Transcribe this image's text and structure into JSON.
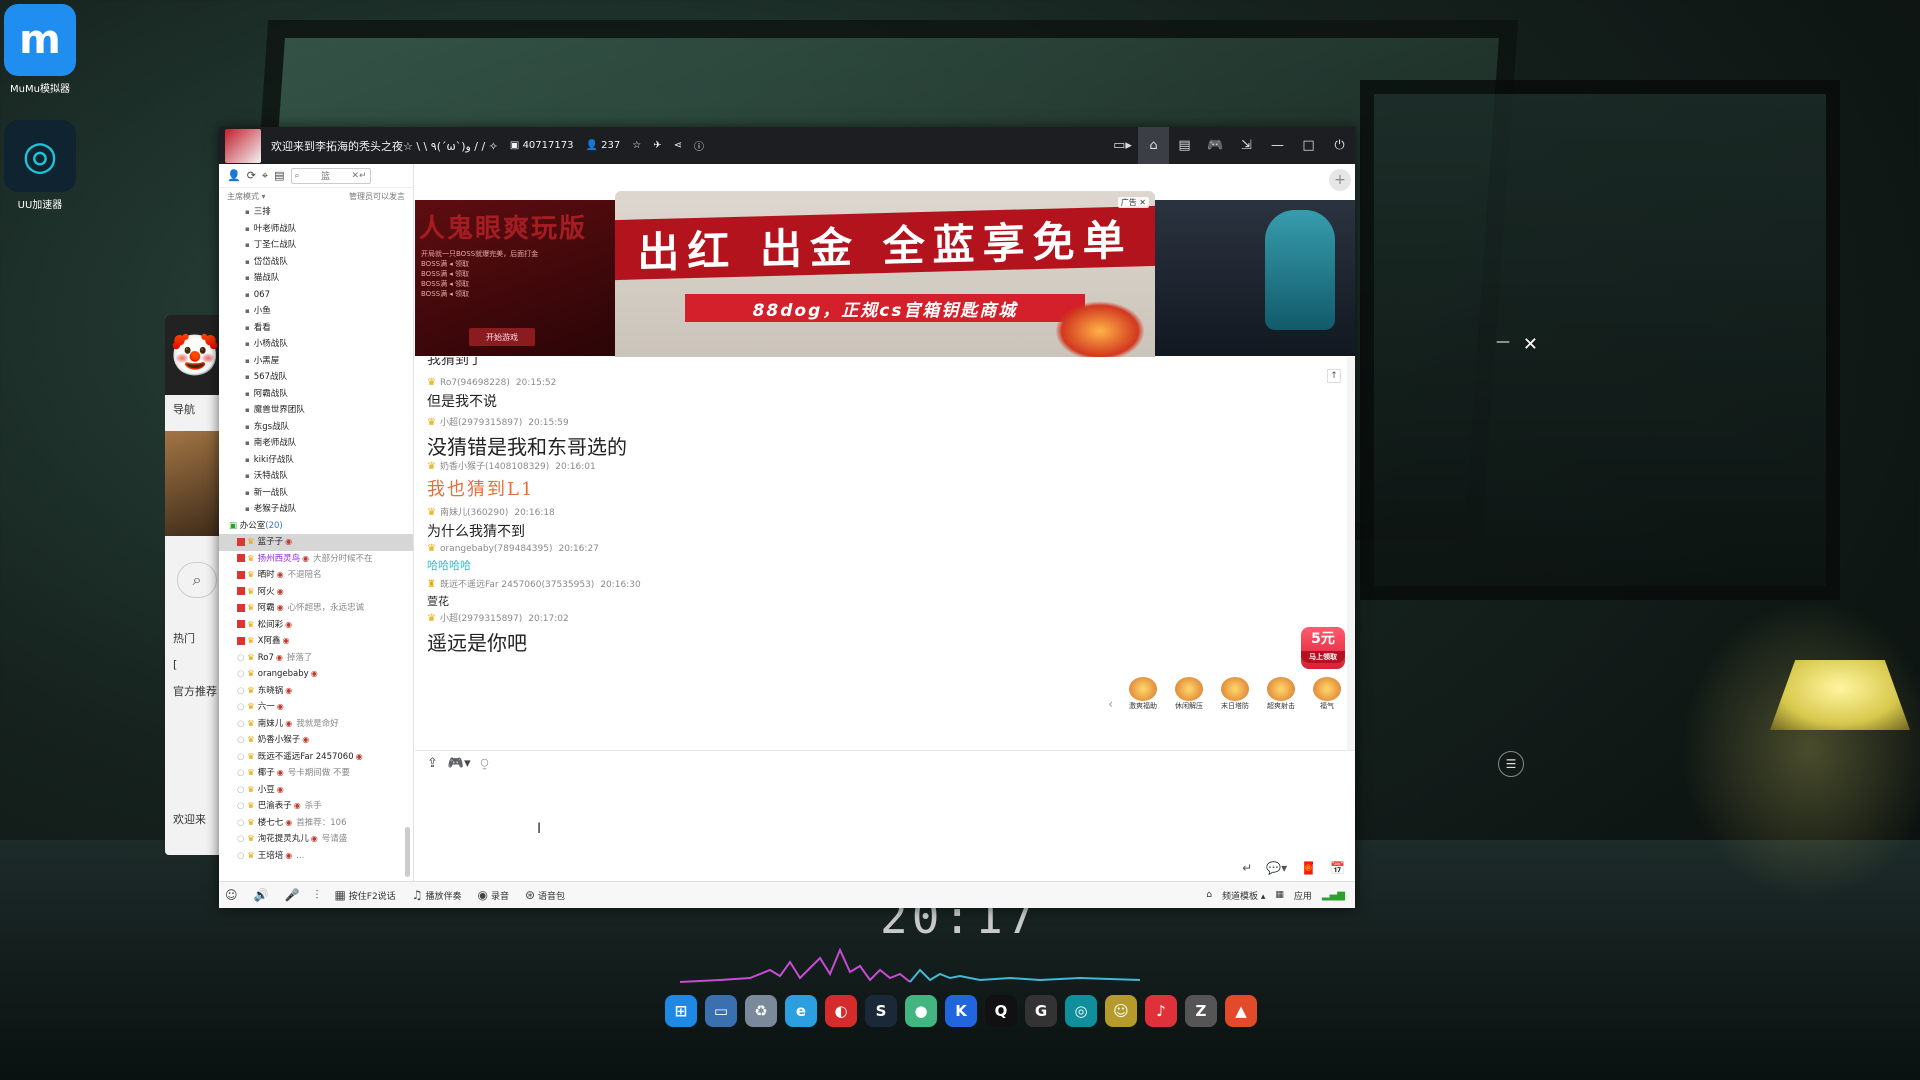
{
  "desktop": {
    "icons": [
      {
        "label": "MuMu模拟器",
        "glyph": "m",
        "color": "#1f8ef0"
      },
      {
        "label": "UU加速器",
        "glyph": "◎",
        "color": "#1aa7b5"
      }
    ],
    "clock": "20:17"
  },
  "taskbar": {
    "apps": [
      {
        "name": "windows-start-icon",
        "glyph": "⊞",
        "color": "#1e88e5"
      },
      {
        "name": "explorer-icon",
        "glyph": "▭",
        "color": "#3a6fb0"
      },
      {
        "name": "recycle-bin-icon",
        "glyph": "♻",
        "color": "#7a8a9a"
      },
      {
        "name": "edge-icon",
        "glyph": "e",
        "color": "#2b9fe0"
      },
      {
        "name": "netease-icon",
        "glyph": "◐",
        "color": "#d62b2b"
      },
      {
        "name": "steam-icon",
        "glyph": "S",
        "color": "#1b2838"
      },
      {
        "name": "colorful-app-icon",
        "glyph": "●",
        "color": "#43b581"
      },
      {
        "name": "k-app-icon",
        "glyph": "K",
        "color": "#2266dd"
      },
      {
        "name": "qq-icon",
        "glyph": "Q",
        "color": "#111111"
      },
      {
        "name": "g-app-icon",
        "glyph": "G",
        "color": "#333333"
      },
      {
        "name": "uu-icon",
        "glyph": "◎",
        "color": "#0f8f9c"
      },
      {
        "name": "monkey-app-icon",
        "glyph": "☺",
        "color": "#b59a2c"
      },
      {
        "name": "music-icon",
        "glyph": "♪",
        "color": "#e0303a"
      },
      {
        "name": "zip-app-icon",
        "glyph": "Z",
        "color": "#555555"
      },
      {
        "name": "bird-app-icon",
        "glyph": "▲",
        "color": "#e24a2a"
      }
    ]
  },
  "side_app": {
    "nav_label": "导航",
    "hot_label": "热门",
    "item2": "[",
    "recommend": "官方推荐",
    "bottom_text": "欢迎来"
  },
  "window": {
    "title": "欢迎来到李拓海的秃头之夜☆ \\ \\ ٩(ˊωˋ)و / / ✧",
    "room_id": "40717173",
    "online_count": "237",
    "tools": [
      "▭▸",
      "⌂",
      "▤",
      "🎮",
      "⇲",
      "—",
      "□",
      "⏻"
    ]
  },
  "left_panel": {
    "search_value": "篮",
    "mode_label": "主席模式 ▾",
    "mode_note": "管理员可以发言",
    "groups": [
      "三排",
      "叶老师战队",
      "丁圣仁战队",
      "岱岱战队",
      "猫战队",
      "067",
      "小鱼",
      "看看",
      "小杨战队",
      "小黑屋",
      "567战队",
      "阿霸战队",
      "魔兽世界团队",
      "东gs战队",
      "南老师战队",
      "kiki仔战队",
      "沃特战队",
      "新一战队",
      "老猴子战队"
    ],
    "office_name": "办公室",
    "office_count": "(20)",
    "users": [
      {
        "name": "篮子子",
        "sig": "",
        "selected": true
      },
      {
        "name": "扬州西灵鸟",
        "sig": "大部分时候不在",
        "purple": true
      },
      {
        "name": "晒时",
        "sig": "不退陪名"
      },
      {
        "name": "阿火",
        "sig": ""
      },
      {
        "name": "阿霸",
        "sig": "心怀超思，永远忠诚"
      },
      {
        "name": "松间彩",
        "sig": ""
      },
      {
        "name": "X阿鑫",
        "sig": ""
      },
      {
        "name": "Ro7",
        "sig": "掉落了"
      },
      {
        "name": "orangebaby",
        "sig": ""
      },
      {
        "name": "东晓锅",
        "sig": ""
      },
      {
        "name": "六一",
        "sig": ""
      },
      {
        "name": "南妹儿",
        "sig": "我就是命好"
      },
      {
        "name": "奶香小猴子",
        "sig": ""
      },
      {
        "name": "既远不遥远Far 2457060",
        "sig": ""
      },
      {
        "name": "椰子",
        "sig": "号卡期间做 不要"
      },
      {
        "name": "小豆",
        "sig": ""
      },
      {
        "name": "巴渝表子",
        "sig": "杀手"
      },
      {
        "name": "楼七七",
        "sig": "首推荐：106"
      },
      {
        "name": "洵花提灵丸儿",
        "sig": "号请盛"
      },
      {
        "name": "王培培",
        "sig": "..."
      }
    ]
  },
  "banner": {
    "left_title": "人鬼眼爽玩版",
    "left_lines": [
      "开局就一只BOSS就爆完美，后面打金",
      "BOSS满  ◂ 领取",
      "BOSS满  ◂ 领取",
      "BOSS满  ◂ 领取",
      "BOSS满  ◂ 领取"
    ],
    "left_button": "开始游戏",
    "ad_headline": "出红  出金  全蓝享免单",
    "ad_sub": "88dog，正规cs官箱钥匙商城",
    "ad_tag": "广告 ✕"
  },
  "chat": {
    "cut_text": "我猜到了",
    "messages": [
      {
        "user": "Ro7(94698228)",
        "time": "20:15:52",
        "text": "但是我不说",
        "style": "s14",
        "crown": "♛"
      },
      {
        "user": "小超(2979315897)",
        "time": "20:15:59",
        "text": "没猜错是我和东哥选的",
        "style": "s20",
        "crown": "♛"
      },
      {
        "user": "奶香小猴子(1408108329)",
        "time": "20:16:01",
        "text": "我也猜到L1",
        "style": "orange",
        "crown": "♛"
      },
      {
        "user": "南妹儿(360290)",
        "time": "20:16:18",
        "text": "为什么我猜不到",
        "style": "s14",
        "crown": "♛"
      },
      {
        "user": "orangebaby(789484395)",
        "time": "20:16:27",
        "text": "哈哈哈哈",
        "style": "teal",
        "crown": "♛"
      },
      {
        "user": "既远不遥远Far 2457060(37535953)",
        "time": "20:16:30",
        "text": "萱花",
        "style": "s11",
        "crown": "♜"
      },
      {
        "user": "小超(2979315897)",
        "time": "20:17:02",
        "text": "遥远是你吧",
        "style": "s20",
        "crown": "♛"
      }
    ],
    "promo_amount": "5元",
    "promo_note": "马上领取",
    "gifts": [
      "激爽福助",
      "休闲解压",
      "末日塔防",
      "超爽射击",
      "福气"
    ]
  },
  "bottombar": {
    "items": [
      {
        "icon": "🔊",
        "label": ""
      },
      {
        "icon": "🎤",
        "label": ""
      },
      {
        "icon": "⫶",
        "label": ""
      },
      {
        "icon": "▦",
        "label": "按住F2说话"
      },
      {
        "icon": "♫",
        "label": "播放伴奏"
      },
      {
        "icon": "◉",
        "label": "录音"
      },
      {
        "icon": "⊛",
        "label": "语音包"
      }
    ],
    "right": {
      "template": "频道模板 ▴",
      "apps": "应用"
    }
  }
}
